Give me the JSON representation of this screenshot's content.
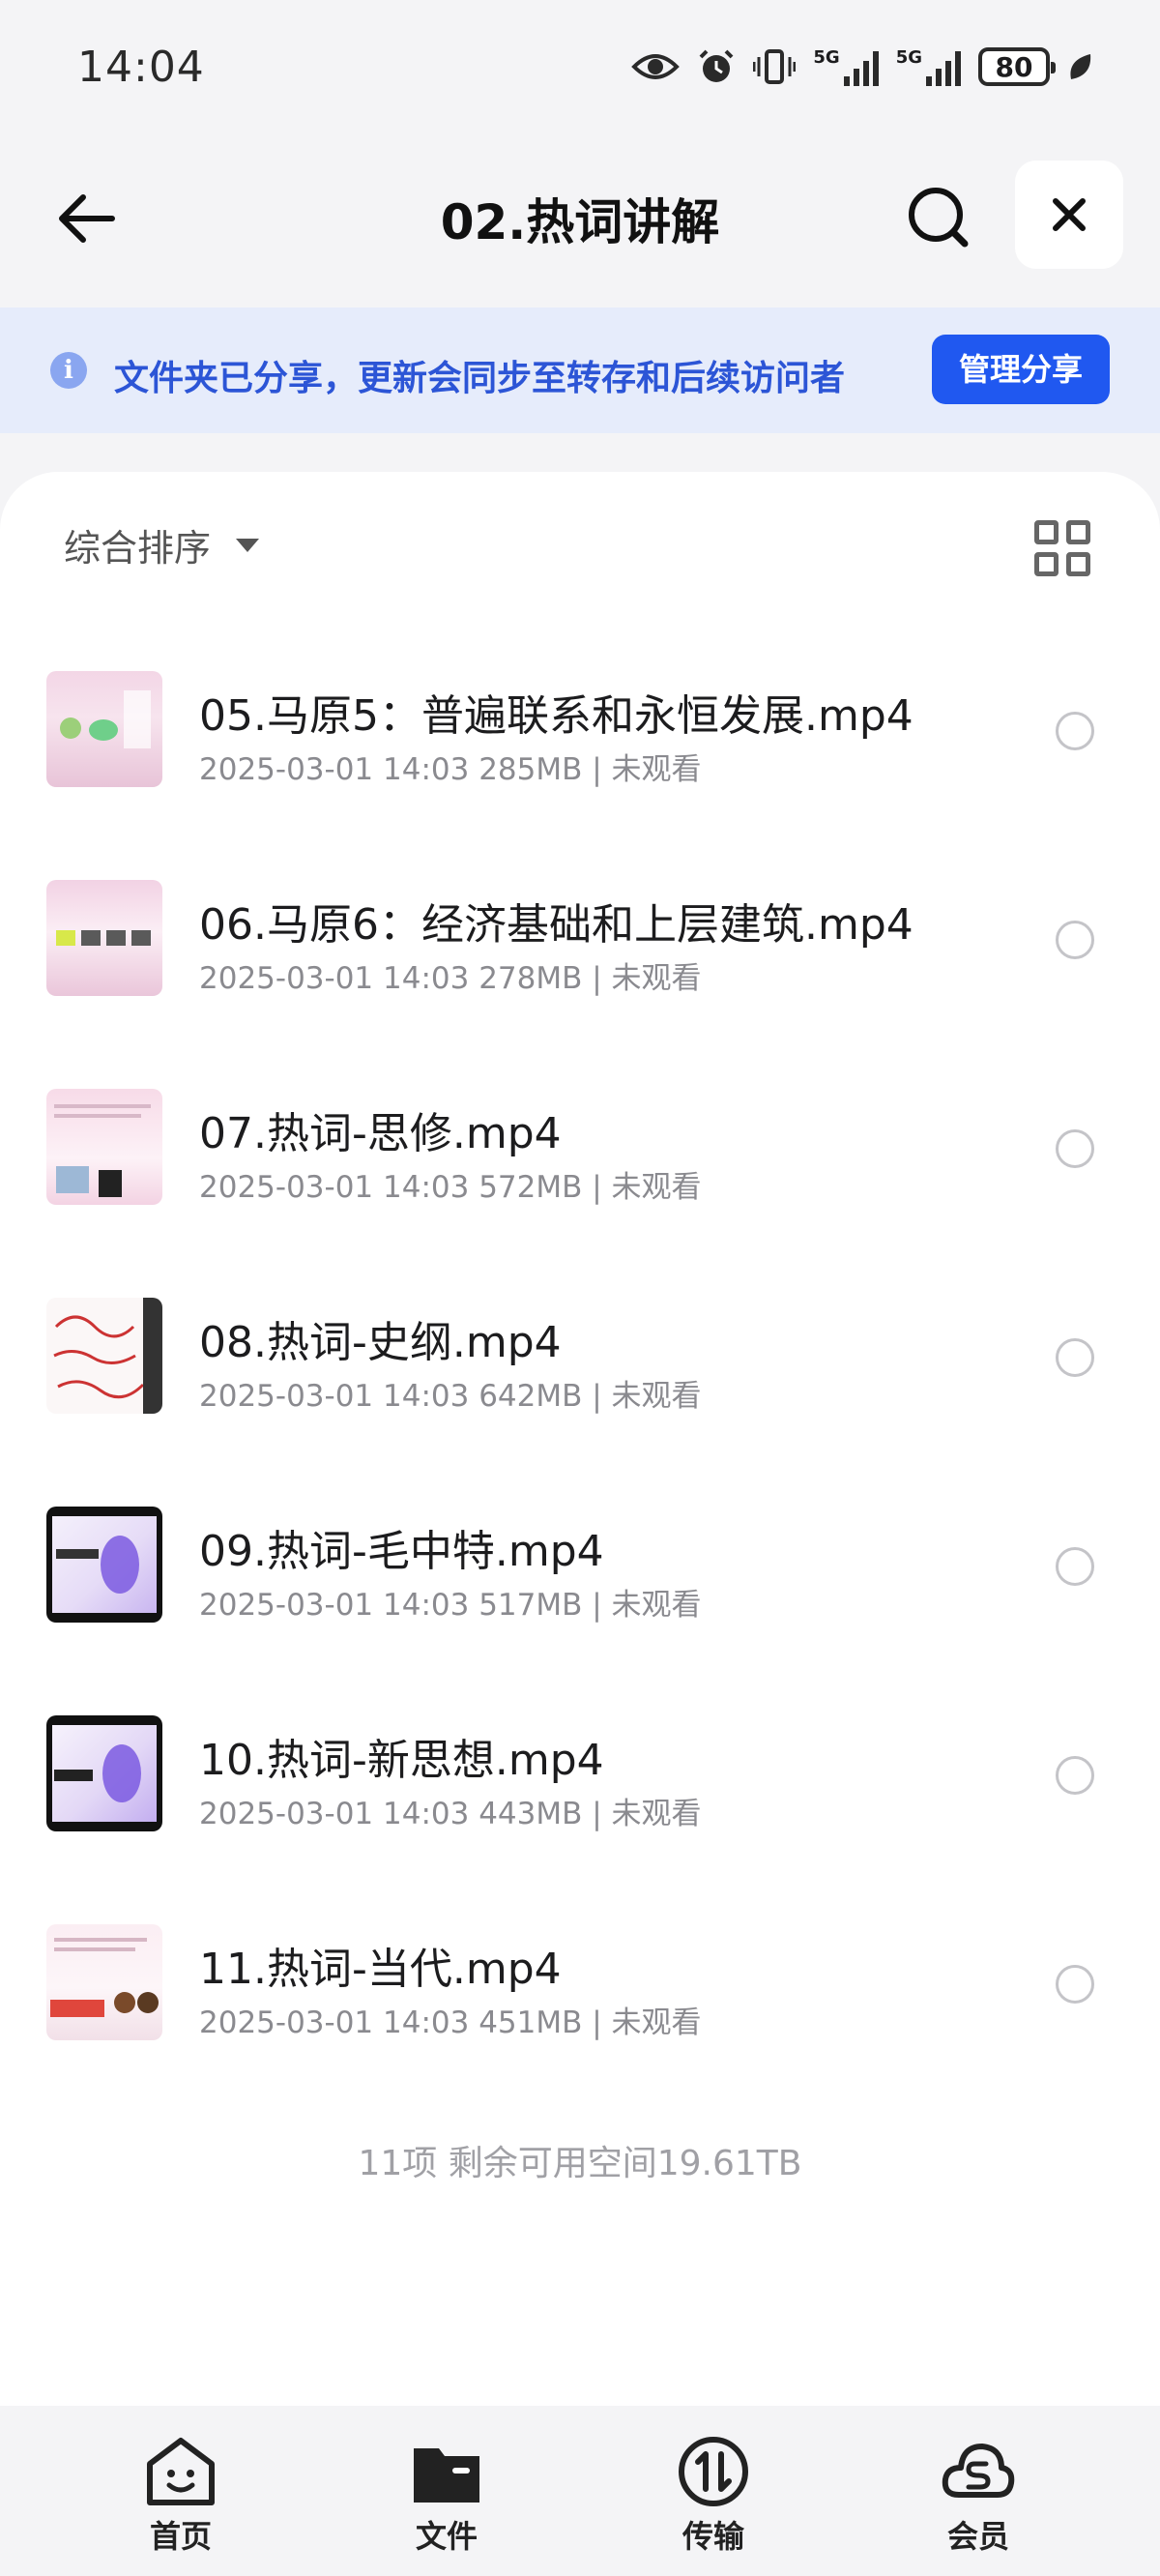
{
  "status_bar": {
    "time": "14:04",
    "network_label_1": "5G",
    "network_label_2": "5G",
    "battery": "80"
  },
  "header": {
    "title": "02.热词讲解"
  },
  "banner": {
    "text": "文件夹已分享，更新会同步至转存和后续访问者",
    "button": "管理分享",
    "info_glyph": "i"
  },
  "sort": {
    "label": "综合排序"
  },
  "files": [
    {
      "name": "05.马原5：普遍联系和永恒发展.mp4",
      "meta": "2025-03-01 14:03  285MB | 未观看"
    },
    {
      "name": "06.马原6：经济基础和上层建筑.mp4",
      "meta": "2025-03-01 14:03  278MB | 未观看"
    },
    {
      "name": "07.热词-思修.mp4",
      "meta": "2025-03-01 14:03  572MB | 未观看"
    },
    {
      "name": "08.热词-史纲.mp4",
      "meta": "2025-03-01 14:03  642MB | 未观看"
    },
    {
      "name": "09.热词-毛中特.mp4",
      "meta": "2025-03-01 14:03  517MB | 未观看"
    },
    {
      "name": "10.热词-新思想.mp4",
      "meta": "2025-03-01 14:03  443MB | 未观看"
    },
    {
      "name": "11.热词-当代.mp4",
      "meta": "2025-03-01 14:03  451MB | 未观看"
    }
  ],
  "footer": {
    "summary": "11项 剩余可用空间19.61TB"
  },
  "tabs": [
    {
      "label": "首页"
    },
    {
      "label": "文件"
    },
    {
      "label": "传输"
    },
    {
      "label": "会员"
    }
  ],
  "colors": {
    "accent": "#2058f0",
    "banner_bg": "#e6ecfb",
    "banner_text": "#2c55d6"
  }
}
